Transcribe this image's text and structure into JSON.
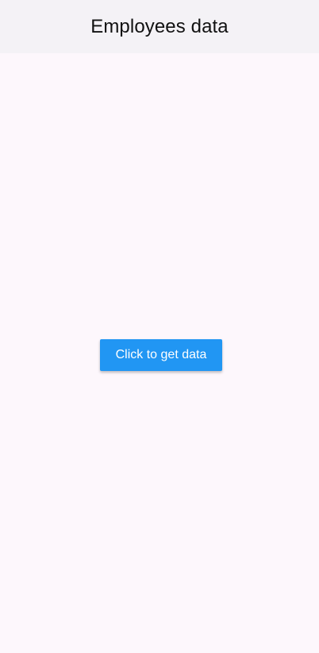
{
  "app_bar": {
    "title": "Employees data"
  },
  "main": {
    "get_data_button_label": "Click to get data"
  },
  "colors": {
    "background": "#fdf7fc",
    "app_bar": "#f4f2f6",
    "button": "#2196f3",
    "button_text": "#ffffff",
    "title_text": "#111111"
  }
}
